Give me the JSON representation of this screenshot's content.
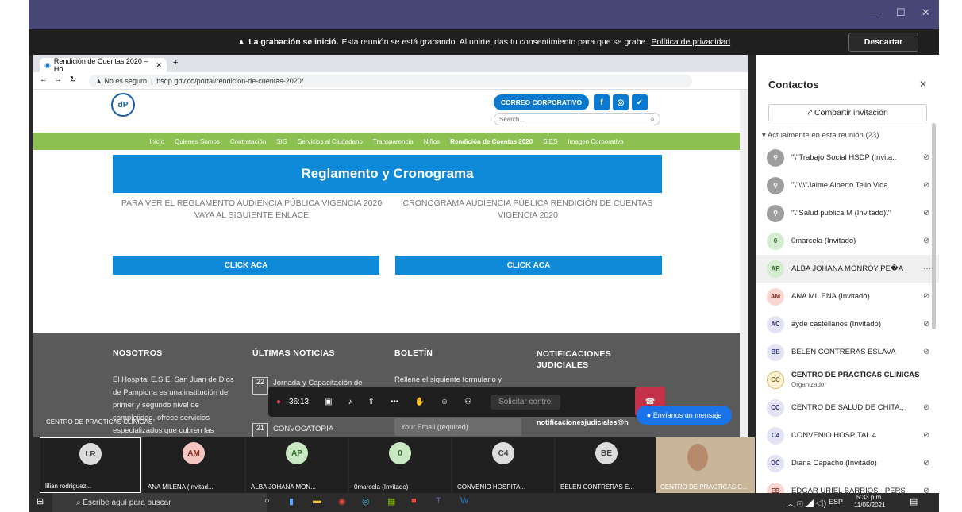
{
  "teams": {
    "banner_bold": "La grabación se inició.",
    "banner_text": "Esta reunión se está grabando. Al unirte, das tu consentimiento para que se grabe.",
    "banner_link": "Política de privacidad",
    "dismiss": "Descartar"
  },
  "browser": {
    "tab_title": "Rendición de Cuentas 2020 – Ho",
    "insecure": "No es seguro",
    "url": "hsdp.gov.co/portal/rendicion-de-cuentas-2020/"
  },
  "site": {
    "corporate_button": "CORREO CORPORATIVO",
    "search_placeholder": "Search...",
    "nav": [
      "Inicio",
      "Quienes Somos",
      "Contratación",
      "SIG",
      "Servicios al Ciudadano",
      "Transparencia",
      "Niños",
      "Rendición de Cuentas 2020",
      "SIES",
      "Imagen Corporativa"
    ],
    "section_title": "Reglamento y Cronograma",
    "left_desc": "PARA VER EL REGLAMENTO AUDIENCIA PÚBLICA VIGENCIA 2020 VAYA AL SIGUIENTE ENLACE",
    "right_desc": "CRONOGRAMA AUDIENCIA PÚBLICA RENDICIÓN DE CUENTAS VIGENCIA 2020",
    "click_left": "CLICK ACA",
    "click_right": "CLICK ACA",
    "footer": {
      "nosotros": "NOSOTROS",
      "nosotros_text": "El Hospital E.S.E. San Juan de Dios de Pamplona es una institución de primer y segundo nivel de complejidad, ofrece servicios especializados que cubren las",
      "noticias": "ÚLTIMAS NOTICIAS",
      "news1_day": "22",
      "news1": "Jornada y Capacitación de",
      "news2_day": "21",
      "news2": "CONVOCATORIA",
      "boletin": "BOLETÍN",
      "boletin_text": "Rellene el siguiente formulario y",
      "email_placeholder": "Your Email (required)",
      "notif": "NOTIFICACIONES JUDICIALES",
      "notif_email": "notificacionesjudiciales@h"
    },
    "message_button": "Envíanos un mensaje"
  },
  "call": {
    "timer": "36:13",
    "request_control": "Solicitar control",
    "presenter_label": "CENTRO DE PRACTICAS CLINICAS"
  },
  "strip": [
    {
      "initials": "LR",
      "name": "lilian rodriguez...",
      "color": "#dcdcdc",
      "fg": "#444"
    },
    {
      "initials": "AM",
      "name": "ANA MILENA (Invitad...",
      "color": "#f5c6bf",
      "fg": "#8a2f22"
    },
    {
      "initials": "AP",
      "name": "ALBA JOHANA MON...",
      "color": "#c9e7c2",
      "fg": "#2f6e26"
    },
    {
      "initials": "0",
      "name": "0marcela (Invitado)",
      "color": "#c9e7c2",
      "fg": "#2f6e26"
    },
    {
      "initials": "C4",
      "name": "CONVENIO HOSPITA...",
      "color": "#dcdcdc",
      "fg": "#444"
    },
    {
      "initials": "BE",
      "name": "BELEN CONTRERAS E...",
      "color": "#dcdcdc",
      "fg": "#444"
    }
  ],
  "video_label": "CENTRO DE PRACTICAS C...",
  "panel": {
    "title": "Contactos",
    "share": "Compartir invitación",
    "in_meeting": "Actualmente en esta reunión (23)",
    "participants": [
      {
        "initials": "",
        "name": "\"\\\"Trabajo Social HSDP (Invita..",
        "color": "#9e9e9e",
        "fg": "#fff"
      },
      {
        "initials": "",
        "name": "\"\\\"\\\\\\\"Jaime Alberto Tello Vida",
        "color": "#9e9e9e",
        "fg": "#fff"
      },
      {
        "initials": "",
        "name": "\"\\\"Salud publica M (Invitado)\\\"",
        "color": "#9e9e9e",
        "fg": "#fff"
      },
      {
        "initials": "0",
        "name": "0marcela (Invitado)",
        "color": "#d4edd0",
        "fg": "#2f6e26"
      },
      {
        "initials": "AP",
        "name": "ALBA JOHANA MONROY PE�A",
        "color": "#d4edd0",
        "fg": "#2f6e26"
      },
      {
        "initials": "AM",
        "name": "ANA MILENA (Invitado)",
        "color": "#f8d7d2",
        "fg": "#8a2f22"
      },
      {
        "initials": "AC",
        "name": "ayde castellanos (Invitado)",
        "color": "#e3e3f3",
        "fg": "#3b3b7a"
      },
      {
        "initials": "BE",
        "name": "BELEN CONTRERAS ESLAVA",
        "color": "#e3e3f3",
        "fg": "#3b3b7a"
      },
      {
        "initials": "CC",
        "name": "CENTRO DE PRACTICAS CLINICAS",
        "sub": "Organizador",
        "color": "#fff2d6",
        "fg": "#8a6a1f"
      },
      {
        "initials": "CC",
        "name": "CENTRO DE SALUD DE CHITA..",
        "color": "#e3e3f3",
        "fg": "#3b3b7a"
      },
      {
        "initials": "C4",
        "name": "CONVENIO HOSPITAL 4",
        "color": "#e3e3f3",
        "fg": "#3b3b7a"
      },
      {
        "initials": "DC",
        "name": "Diana Capacho (Invitado)",
        "color": "#e3e3f3",
        "fg": "#3b3b7a"
      },
      {
        "initials": "EB",
        "name": "EDGAR URIEL BARRIOS - PERS",
        "color": "#f8d7d2",
        "fg": "#8a2f22"
      }
    ]
  },
  "taskbar": {
    "search": "Escribe aquí para buscar",
    "lang": "ESP",
    "time": "5:33 p.m.",
    "date": "11/05/2021"
  }
}
